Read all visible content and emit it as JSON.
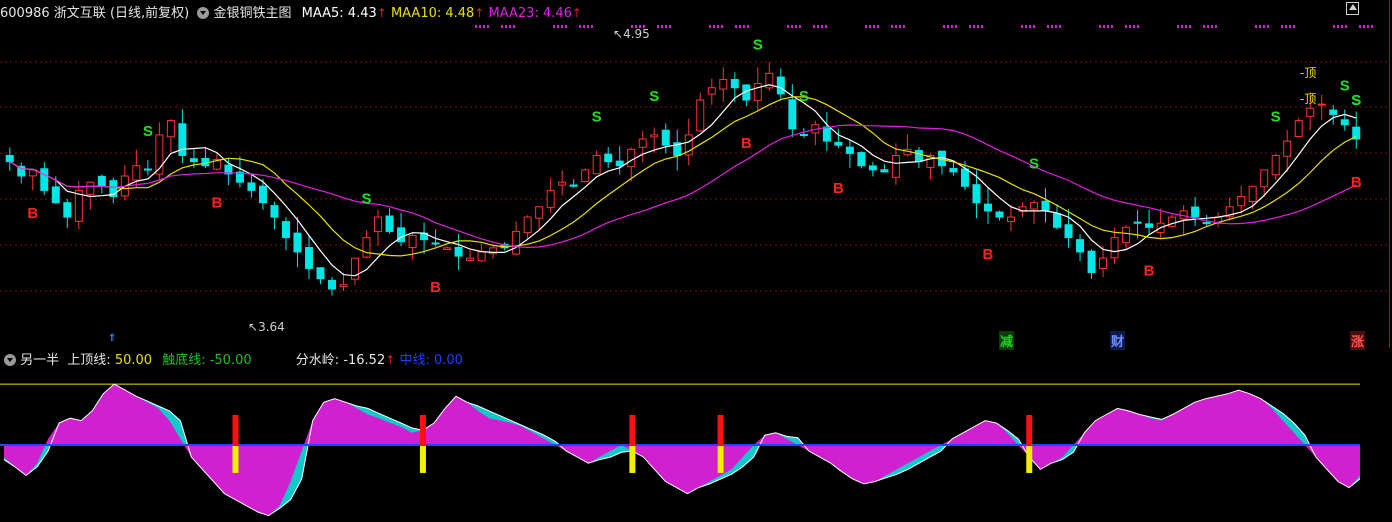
{
  "main_panel": {
    "stock_code": "600986",
    "stock_name": "浙文互联",
    "period": "(日线,前复权)",
    "indicator_name": "金银铜铁主图",
    "ma": [
      {
        "label": "MAA5: 4.43",
        "color": "#ffffff"
      },
      {
        "label": "MAA10: 4.48",
        "color": "#e8e000"
      },
      {
        "label": "MAA23: 4.46",
        "color": "#e020e0"
      }
    ],
    "high_label": "4.95",
    "low_label": "3.64",
    "event_marks": [
      {
        "text": "减",
        "color": "#20c020"
      },
      {
        "text": "财",
        "color": "#4060ff"
      },
      {
        "text": "涨",
        "color": "#ff4040"
      }
    ]
  },
  "sub_panel": {
    "indicator_name": "另一半",
    "top_line_label": "上顶线:",
    "top_line_value": "50.00",
    "bottom_line_label": "触底线:",
    "bottom_line_value": "-50.00",
    "divide_label": "分水岭:",
    "divide_value": "-16.52",
    "mid_label": "中线:",
    "mid_value": "0.00"
  },
  "chart_data": [
    {
      "type": "candlestick",
      "title": "600986 浙文互联 (日线,前复权) 金银铜铁主图",
      "series_colors": {
        "up": "#ff3232",
        "down": "#00e5e5",
        "maa5": "#ffffff",
        "maa10": "#e8e000",
        "maa23": "#e020e0"
      },
      "ylim": [
        3.5,
        5.0
      ],
      "price_path": [
        4.32,
        4.25,
        4.28,
        4.18,
        4.12,
        4.05,
        4.18,
        4.22,
        4.2,
        4.15,
        4.25,
        4.3,
        4.28,
        4.45,
        4.52,
        4.35,
        4.32,
        4.3,
        4.33,
        4.26,
        4.22,
        4.18,
        4.12,
        4.05,
        3.95,
        3.88,
        3.8,
        3.75,
        3.7,
        3.72,
        3.85,
        3.95,
        4.05,
        3.98,
        3.93,
        3.96,
        3.94,
        3.92,
        3.9,
        3.86,
        3.85,
        3.88,
        3.9,
        3.9,
        3.98,
        4.05,
        4.1,
        4.18,
        4.22,
        4.2,
        4.28,
        4.35,
        4.32,
        4.3,
        4.38,
        4.43,
        4.45,
        4.4,
        4.35,
        4.45,
        4.62,
        4.68,
        4.72,
        4.68,
        4.62,
        4.7,
        4.75,
        4.65,
        4.48,
        4.45,
        4.5,
        4.42,
        4.4,
        4.36,
        4.3,
        4.28,
        4.27,
        4.35,
        4.38,
        4.32,
        4.35,
        4.3,
        4.27,
        4.2,
        4.12,
        4.08,
        4.05,
        4.05,
        4.1,
        4.12,
        4.08,
        4.0,
        3.95,
        3.88,
        3.78,
        3.85,
        3.95,
        4.0,
        4.02,
        4.0,
        4.02,
        4.05,
        4.08,
        4.05,
        4.02,
        4.05,
        4.1,
        4.15,
        4.2,
        4.28,
        4.35,
        4.42,
        4.52,
        4.58,
        4.6,
        4.55,
        4.5,
        4.43
      ],
      "signals": [
        {
          "type": "S",
          "index": 12
        },
        {
          "type": "S",
          "index": 31
        },
        {
          "type": "S",
          "index": 51
        },
        {
          "type": "S",
          "index": 56
        },
        {
          "type": "S",
          "index": 65
        },
        {
          "type": "S",
          "index": 69
        },
        {
          "type": "S",
          "index": 89
        },
        {
          "type": "S",
          "index": 110
        },
        {
          "type": "S",
          "index": 116
        },
        {
          "type": "S",
          "index": 123
        },
        {
          "type": "S",
          "index": 130
        },
        {
          "type": "B",
          "index": 2
        },
        {
          "type": "B",
          "index": 18
        },
        {
          "type": "B",
          "index": 37
        },
        {
          "type": "B",
          "index": 64
        },
        {
          "type": "B",
          "index": 72
        },
        {
          "type": "B",
          "index": 85
        },
        {
          "type": "B",
          "index": 99
        },
        {
          "type": "B",
          "index": 134
        }
      ],
      "top_marks": [
        "顶",
        "顶"
      ]
    },
    {
      "type": "area",
      "title": "另一半",
      "ylim": [
        -60,
        55
      ],
      "top_line": 50,
      "bottom_line": -50,
      "mid_line": 0,
      "series": [
        {
          "name": "另一半",
          "color": "#d020d0",
          "values": [
            -10,
            -18,
            -25,
            -15,
            5,
            18,
            22,
            20,
            28,
            42,
            50,
            45,
            40,
            35,
            30,
            20,
            5,
            -10,
            -20,
            -30,
            -40,
            -45,
            -50,
            -55,
            -58,
            -50,
            -30,
            -5,
            20,
            35,
            38,
            35,
            30,
            25,
            22,
            18,
            15,
            10,
            12,
            18,
            30,
            40,
            35,
            28,
            22,
            20,
            18,
            15,
            10,
            5,
            0,
            -5,
            -10,
            -15,
            -10,
            -5,
            0,
            -5,
            -10,
            -20,
            -30,
            -35,
            -40,
            -35,
            -30,
            -25,
            -20,
            -10,
            0,
            8,
            10,
            5,
            0,
            -5,
            -10,
            -15,
            -22,
            -28,
            -32,
            -30,
            -25,
            -20,
            -15,
            -10,
            -5,
            0,
            5,
            10,
            15,
            20,
            18,
            10,
            0,
            -10,
            -20,
            -15,
            -10,
            0,
            10,
            20,
            25,
            30,
            28,
            25,
            22,
            20,
            25,
            30,
            35,
            38,
            40,
            42,
            45,
            42,
            38,
            30,
            20,
            10,
            0,
            -10,
            -20,
            -30,
            -35,
            -25
          ]
        },
        {
          "name": "分水岭",
          "color": "#00c8c8",
          "values": [
            -12,
            -16,
            -20,
            -18,
            -5,
            8,
            15,
            18,
            22,
            30,
            36,
            40,
            38,
            36,
            32,
            28,
            20,
            8,
            -5,
            -18,
            -28,
            -38,
            -44,
            -48,
            -52,
            -52,
            -45,
            -28,
            -8,
            12,
            26,
            32,
            32,
            30,
            26,
            22,
            18,
            14,
            12,
            14,
            22,
            30,
            33,
            32,
            28,
            24,
            20,
            16,
            12,
            8,
            3,
            -2,
            -6,
            -10,
            -12,
            -10,
            -6,
            -4,
            -6,
            -12,
            -20,
            -26,
            -32,
            -34,
            -32,
            -28,
            -24,
            -18,
            -10,
            -2,
            4,
            7,
            6,
            3,
            -2,
            -8,
            -14,
            -20,
            -25,
            -28,
            -27,
            -24,
            -20,
            -15,
            -10,
            -5,
            0,
            5,
            10,
            14,
            15,
            12,
            5,
            -4,
            -12,
            -14,
            -12,
            -6,
            2,
            12,
            18,
            22,
            24,
            24,
            23,
            21,
            22,
            25,
            29,
            32,
            34,
            36,
            38,
            38,
            36,
            32,
            26,
            18,
            8,
            -2,
            -12,
            -20,
            -26,
            -28
          ]
        }
      ],
      "signal_bars_index": [
        21,
        38,
        57,
        65,
        93
      ]
    }
  ]
}
